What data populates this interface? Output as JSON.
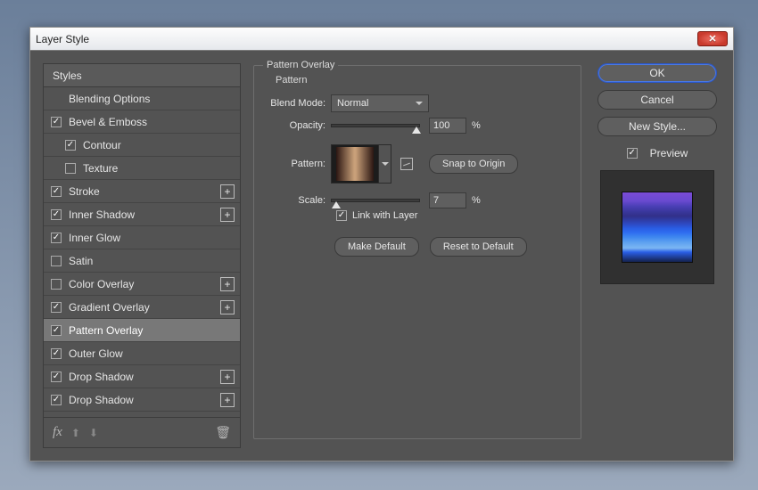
{
  "window": {
    "title": "Layer Style"
  },
  "sidebar": {
    "header": "Styles",
    "blending": "Blending Options",
    "items": [
      {
        "label": "Bevel & Emboss",
        "checked": true,
        "addable": false,
        "indent": 0
      },
      {
        "label": "Contour",
        "checked": true,
        "addable": false,
        "indent": 1
      },
      {
        "label": "Texture",
        "checked": false,
        "addable": false,
        "indent": 1
      },
      {
        "label": "Stroke",
        "checked": true,
        "addable": true,
        "indent": 0
      },
      {
        "label": "Inner Shadow",
        "checked": true,
        "addable": true,
        "indent": 0
      },
      {
        "label": "Inner Glow",
        "checked": true,
        "addable": false,
        "indent": 0
      },
      {
        "label": "Satin",
        "checked": false,
        "addable": false,
        "indent": 0
      },
      {
        "label": "Color Overlay",
        "checked": false,
        "addable": true,
        "indent": 0
      },
      {
        "label": "Gradient Overlay",
        "checked": true,
        "addable": true,
        "indent": 0
      },
      {
        "label": "Pattern Overlay",
        "checked": true,
        "addable": false,
        "indent": 0,
        "selected": true
      },
      {
        "label": "Outer Glow",
        "checked": true,
        "addable": false,
        "indent": 0
      },
      {
        "label": "Drop Shadow",
        "checked": true,
        "addable": true,
        "indent": 0
      },
      {
        "label": "Drop Shadow",
        "checked": true,
        "addable": true,
        "indent": 0
      }
    ],
    "fx_label": "fx"
  },
  "settings": {
    "legend": "Pattern Overlay",
    "sublegend": "Pattern",
    "blend_mode_label": "Blend Mode:",
    "blend_mode_value": "Normal",
    "opacity_label": "Opacity:",
    "opacity_value": "100",
    "opacity_unit": "%",
    "pattern_label": "Pattern:",
    "snap_label": "Snap to Origin",
    "scale_label": "Scale:",
    "scale_value": "7",
    "scale_unit": "%",
    "link_label": "Link with Layer",
    "link_checked": true,
    "make_default": "Make Default",
    "reset_default": "Reset to Default"
  },
  "right": {
    "ok": "OK",
    "cancel": "Cancel",
    "new_style": "New Style...",
    "preview_label": "Preview",
    "preview_checked": true
  }
}
